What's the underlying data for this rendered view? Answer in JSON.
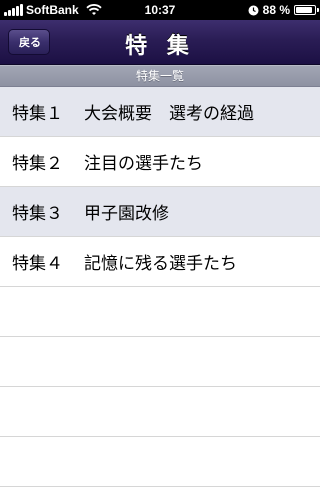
{
  "status_bar": {
    "carrier": "SoftBank",
    "time": "10:37",
    "battery_text": "88 %",
    "battery_level": 0.88,
    "icons": [
      "signal-icon",
      "wifi-icon",
      "clock-icon",
      "battery-icon"
    ]
  },
  "nav": {
    "back_label": "戻る",
    "title": "特 集"
  },
  "section": {
    "title": "特集一覧"
  },
  "items": [
    {
      "number": "特集１",
      "title": "大会概要　選考の経過"
    },
    {
      "number": "特集２",
      "title": "注目の選手たち"
    },
    {
      "number": "特集３",
      "title": "甲子園改修"
    },
    {
      "number": "特集４",
      "title": "記憶に残る選手たち"
    }
  ],
  "colors": {
    "nav_bar": "#2a1d55",
    "section_header": "#9a9eae",
    "row_alt": "#e4e6ee"
  }
}
